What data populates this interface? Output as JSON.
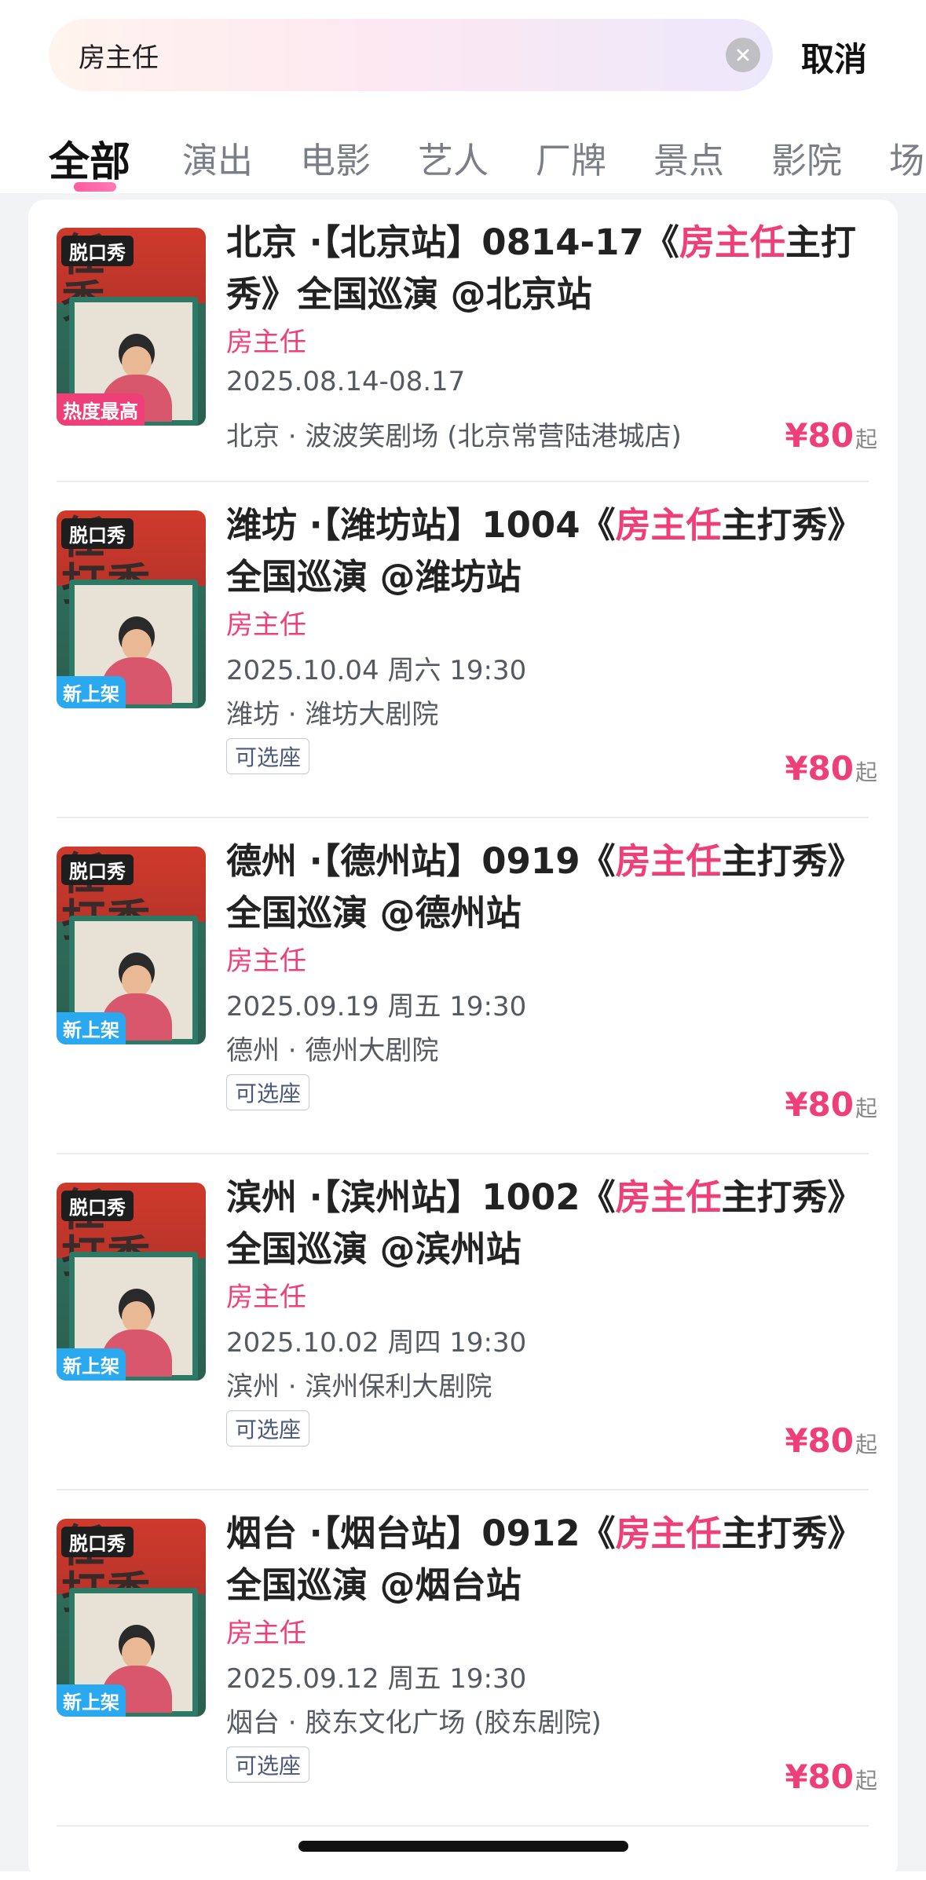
{
  "search": {
    "query": "房主任",
    "cancel_label": "取消"
  },
  "tabs": [
    "全部",
    "演出",
    "电影",
    "艺人",
    "厂牌",
    "景点",
    "影院",
    "场"
  ],
  "items": [
    {
      "title_pre": "北京 ·【北京站】0814-17《",
      "title_hl": "房主任",
      "title_post": "主打秀》全国巡演 @北京站",
      "artist": "房主任",
      "date": "2025.08.14-08.17",
      "venue": "北京 · 波波笑剧场 (北京常营陆港城店)",
      "seat_label": "",
      "price": "¥80",
      "price_unit": "起",
      "poster_top_tag": "脱口秀",
      "poster_bottom_tag": "热度最高"
    },
    {
      "title_pre": "潍坊 ·【潍坊站】1004《",
      "title_hl": "房主任",
      "title_post": "主打秀》全国巡演 @潍坊站",
      "artist": "房主任",
      "date": "2025.10.04 周六 19:30",
      "venue": "潍坊 · 潍坊大剧院",
      "seat_label": "可选座",
      "price": "¥80",
      "price_unit": "起",
      "poster_top_tag": "脱口秀",
      "poster_bottom_tag": "新上架"
    },
    {
      "title_pre": "德州 ·【德州站】0919《",
      "title_hl": "房主任",
      "title_post": "主打秀》全国巡演 @德州站",
      "artist": "房主任",
      "date": "2025.09.19 周五 19:30",
      "venue": "德州 · 德州大剧院",
      "seat_label": "可选座",
      "price": "¥80",
      "price_unit": "起",
      "poster_top_tag": "脱口秀",
      "poster_bottom_tag": "新上架"
    },
    {
      "title_pre": "滨州 ·【滨州站】1002《",
      "title_hl": "房主任",
      "title_post": "主打秀》全国巡演 @滨州站",
      "artist": "房主任",
      "date": "2025.10.02 周四 19:30",
      "venue": "滨州 · 滨州保利大剧院",
      "seat_label": "可选座",
      "price": "¥80",
      "price_unit": "起",
      "poster_top_tag": "脱口秀",
      "poster_bottom_tag": "新上架"
    },
    {
      "title_pre": "烟台 ·【烟台站】0912《",
      "title_hl": "房主任",
      "title_post": "主打秀》全国巡演 @烟台站",
      "artist": "房主任",
      "date": "2025.09.12 周五 19:30",
      "venue": "烟台 · 胶东文化广场 (胶东剧院)",
      "seat_label": "可选座",
      "price": "¥80",
      "price_unit": "起",
      "poster_top_tag": "脱口秀",
      "poster_bottom_tag": "新上架"
    }
  ],
  "colors": {
    "accent": "#ef3f78",
    "new_tag": "#2aa8f0",
    "hot_tag": "#ef3f78"
  }
}
